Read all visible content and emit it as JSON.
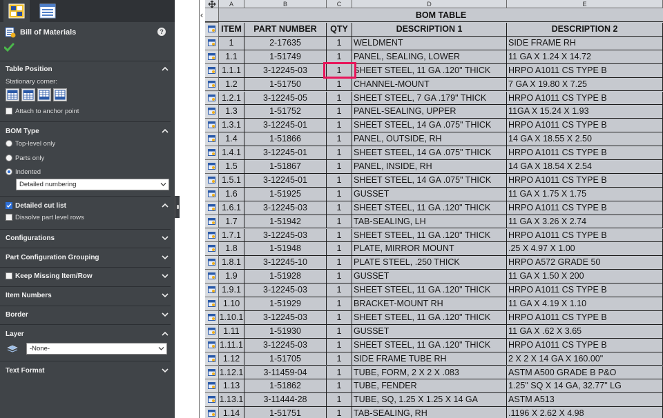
{
  "panel": {
    "title": "Bill of Materials",
    "help": "?",
    "table_position": {
      "heading": "Table Position",
      "stationary_label": "Stationary corner:",
      "attach_label": "Attach to anchor point"
    },
    "bom_type": {
      "heading": "BOM Type",
      "top_level": "Top-level only",
      "parts_only": "Parts only",
      "indented": "Indented",
      "numbering_value": "Detailed numbering"
    },
    "detailed_cut": {
      "heading": "Detailed cut list",
      "dissolve_label": "Dissolve part level rows"
    },
    "sections": {
      "configurations": "Configurations",
      "grouping": "Part Configuration Grouping",
      "keep_missing": "Keep Missing Item/Row",
      "item_numbers": "Item Numbers",
      "border": "Border",
      "layer": "Layer",
      "text_format": "Text Format"
    },
    "layer_value": "-None-"
  },
  "bom": {
    "columns": [
      "A",
      "B",
      "C",
      "D",
      "E"
    ],
    "title": "BOM TABLE",
    "headers": [
      "ITEM",
      "PART NUMBER",
      "QTY",
      "DESCRIPTION 1",
      "DESCRIPTION 2"
    ],
    "rows": [
      [
        "1",
        "2-17635",
        "1",
        "WELDMENT",
        "SIDE FRAME RH"
      ],
      [
        "1.1",
        "1-51749",
        "1",
        "PANEL, SEALING, LOWER",
        "11 GA X 1.24 X 14.72"
      ],
      [
        "1.1.1",
        "3-12245-03",
        "1",
        "SHEET STEEL, 11 GA .120\" THICK",
        "HRPO A1011 CS TYPE B"
      ],
      [
        "1.2",
        "1-51750",
        "1",
        "CHANNEL-MOUNT",
        "7 GA X 19.80 X 7.25"
      ],
      [
        "1.2.1",
        "3-12245-05",
        "1",
        "SHEET STEEL, 7 GA .179\" THICK",
        "HRPO A1011 CS TYPE B"
      ],
      [
        "1.3",
        "1-51752",
        "1",
        "PANEL-SEALING, UPPER",
        "11GA X 15.24 X 1.93"
      ],
      [
        "1.3.1",
        "3-12245-01",
        "1",
        "SHEET STEEL, 14 GA .075\" THICK",
        "HRPO A1011 CS TYPE B"
      ],
      [
        "1.4",
        "1-51866",
        "1",
        "PANEL, OUTSIDE, RH",
        "14 GA X 18.55 X 2.50"
      ],
      [
        "1.4.1",
        "3-12245-01",
        "1",
        "SHEET STEEL, 14 GA .075\" THICK",
        "HRPO A1011 CS TYPE B"
      ],
      [
        "1.5",
        "1-51867",
        "1",
        "PANEL, INSIDE, RH",
        "14 GA X 18.54 X 2.54"
      ],
      [
        "1.5.1",
        "3-12245-01",
        "1",
        "SHEET STEEL, 14 GA .075\" THICK",
        "HRPO A1011 CS TYPE B"
      ],
      [
        "1.6",
        "1-51925",
        "1",
        "GUSSET",
        "11 GA X 1.75 X 1.75"
      ],
      [
        "1.6.1",
        "3-12245-03",
        "1",
        "SHEET STEEL, 11 GA .120\" THICK",
        "HRPO A1011 CS TYPE B"
      ],
      [
        "1.7",
        "1-51942",
        "1",
        "TAB-SEALING, LH",
        "11 GA X 3.26 X 2.74"
      ],
      [
        "1.7.1",
        "3-12245-03",
        "1",
        "SHEET STEEL, 11 GA .120\" THICK",
        "HRPO A1011 CS TYPE B"
      ],
      [
        "1.8",
        "1-51948",
        "1",
        "PLATE, MIRROR MOUNT",
        ".25 X 4.97 X 1.00"
      ],
      [
        "1.8.1",
        "3-12245-10",
        "1",
        "PLATE STEEL, .250 THICK",
        "HRPO A572 GRADE 50"
      ],
      [
        "1.9",
        "1-51928",
        "1",
        "GUSSET",
        "11 GA X 1.50 X 200"
      ],
      [
        "1.9.1",
        "3-12245-03",
        "1",
        "SHEET STEEL, 11 GA .120\" THICK",
        "HRPO A1011 CS TYPE B"
      ],
      [
        "1.10",
        "1-51929",
        "1",
        "BRACKET-MOUNT RH",
        "11 GA X 4.19 X 1.10"
      ],
      [
        "1.10.1",
        "3-12245-03",
        "1",
        "SHEET STEEL, 11 GA .120\" THICK",
        "HRPO A1011 CS TYPE B"
      ],
      [
        "1.11",
        "1-51930",
        "1",
        "GUSSET",
        "11 GA X .62 X 3.65"
      ],
      [
        "1.11.1",
        "3-12245-03",
        "1",
        "SHEET STEEL, 11 GA .120\" THICK",
        "HRPO A1011 CS TYPE B"
      ],
      [
        "1.12",
        "1-51705",
        "1",
        "SIDE FRAME TUBE RH",
        "2 X 2 X 14 GA X 160.00\""
      ],
      [
        "1.12.1",
        "3-11459-04",
        "1",
        "TUBE, FORM, 2 X 2 X .083",
        "ASTM A500 GRADE B P&O"
      ],
      [
        "1.13",
        "1-51862",
        "1",
        "TUBE, FENDER",
        "1.25\" SQ X 14 GA, 32.77\" LG"
      ],
      [
        "1.13.1",
        "3-11444-28",
        "1",
        "TUBE, SQ, 1.25 X 1.25 X 14 GA",
        "ASTM A513"
      ],
      [
        "1.14",
        "1-51751",
        "1",
        "TAB-SEALING, RH",
        ".1196 X 2.62 X 4.98"
      ]
    ]
  },
  "colors": {
    "panel_bg": "#404448",
    "table_bg": "#c6c9cf",
    "highlight": "#e8155a",
    "check_green": "#4bb84b"
  }
}
